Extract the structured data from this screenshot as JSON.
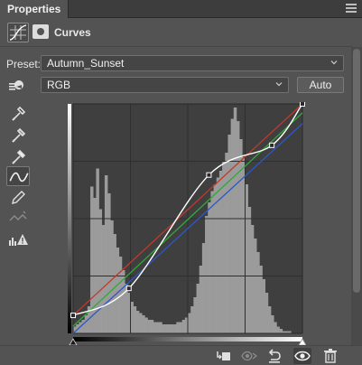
{
  "panel": {
    "tab_label": "Properties",
    "menu_icon": "panel-menu-icon"
  },
  "header": {
    "title": "Curves",
    "icons": [
      "curves-adjustment-icon",
      "layer-mask-icon"
    ]
  },
  "preset": {
    "label": "Preset:",
    "value": "Autumn_Sunset"
  },
  "channel": {
    "value": "RGB",
    "auto_label": "Auto"
  },
  "tools": [
    "on-image-adjust-icon",
    "black-point-eyedropper-icon",
    "gray-point-eyedropper-icon",
    "white-point-eyedropper-icon",
    "curve-points-icon",
    "pencil-icon",
    "smooth-curve-icon",
    "clipping-warning-icon"
  ],
  "graph": {
    "domain": [
      0,
      255
    ],
    "range": [
      0,
      255
    ],
    "grid_divisions": 4,
    "curves": {
      "rgb": {
        "color": "#ffffff",
        "points": [
          [
            0,
            20
          ],
          [
            62,
            50
          ],
          [
            151,
            176
          ],
          [
            221,
            209
          ],
          [
            255,
            255
          ]
        ]
      },
      "red": {
        "color": "#c0392b",
        "points": [
          [
            0,
            20
          ],
          [
            255,
            255
          ]
        ]
      },
      "green": {
        "color": "#2eaa3a",
        "points": [
          [
            0,
            8
          ],
          [
            255,
            245
          ]
        ]
      },
      "blue": {
        "color": "#2b57c9",
        "points": [
          [
            0,
            0
          ],
          [
            255,
            233
          ]
        ]
      }
    },
    "histogram": [
      3,
      4,
      5,
      6,
      8,
      12,
      65,
      60,
      73,
      55,
      48,
      70,
      62,
      50,
      44,
      38,
      34,
      28,
      22,
      18,
      14,
      12,
      10,
      9,
      8,
      7,
      6,
      6,
      5,
      5,
      5,
      4,
      4,
      4,
      4,
      4,
      5,
      5,
      6,
      7,
      9,
      12,
      16,
      22,
      30,
      40,
      52,
      58,
      63,
      66,
      69,
      72,
      76,
      80,
      88,
      95,
      100,
      94,
      86,
      78,
      66,
      56,
      48,
      42,
      36,
      30,
      24,
      18,
      12,
      8,
      5,
      3,
      2,
      1,
      1,
      1,
      0,
      0,
      0,
      0
    ]
  },
  "bottom_bar": {
    "icons": [
      "clip-to-layer-icon",
      "view-previous-state-icon",
      "reset-icon",
      "visibility-eye-icon",
      "trash-icon"
    ]
  },
  "colors": {
    "panel_bg": "#535353",
    "graph_bg": "#3f3f3f",
    "histogram": "#9b9b9b",
    "grid": "#2f2f2f"
  }
}
